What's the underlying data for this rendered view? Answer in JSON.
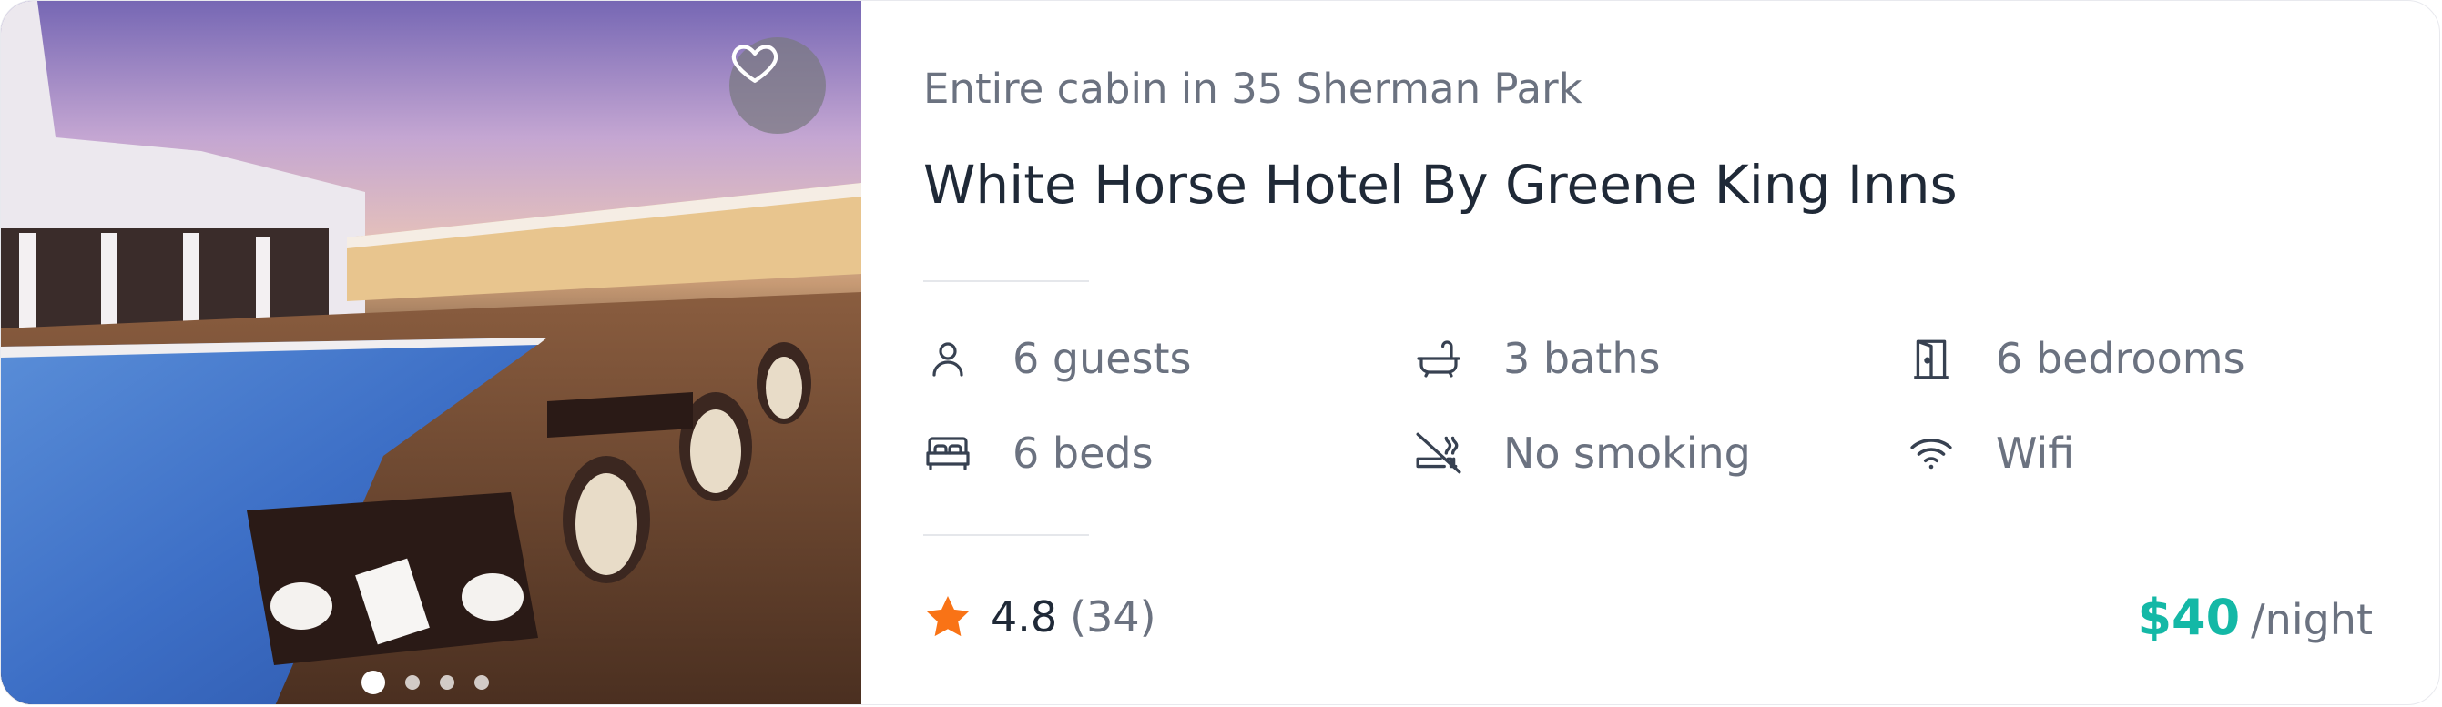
{
  "listing": {
    "subtitle": "Entire cabin in 35 Sherman Park",
    "title": "White Horse Hotel By Greene King Inns",
    "amenities": [
      {
        "icon": "user-icon",
        "label": "6 guests"
      },
      {
        "icon": "bathtub-icon",
        "label": "3 baths"
      },
      {
        "icon": "door-icon",
        "label": "6 bedrooms"
      },
      {
        "icon": "bed-icon",
        "label": "6 beds"
      },
      {
        "icon": "no-smoking-icon",
        "label": "No smoking"
      },
      {
        "icon": "wifi-icon",
        "label": "Wifi"
      }
    ],
    "rating": {
      "icon": "star-icon",
      "value": "4.8",
      "count": "(34)"
    },
    "price": {
      "amount": "$40",
      "unit": "/night"
    }
  },
  "gallery": {
    "favorite_icon": "heart-icon",
    "slides": 4,
    "active_slide": 1
  },
  "colors": {
    "accent_price": "#14b8a6",
    "star": "#f97316",
    "text_muted": "#6b7280",
    "text_dark": "#1f2937"
  }
}
